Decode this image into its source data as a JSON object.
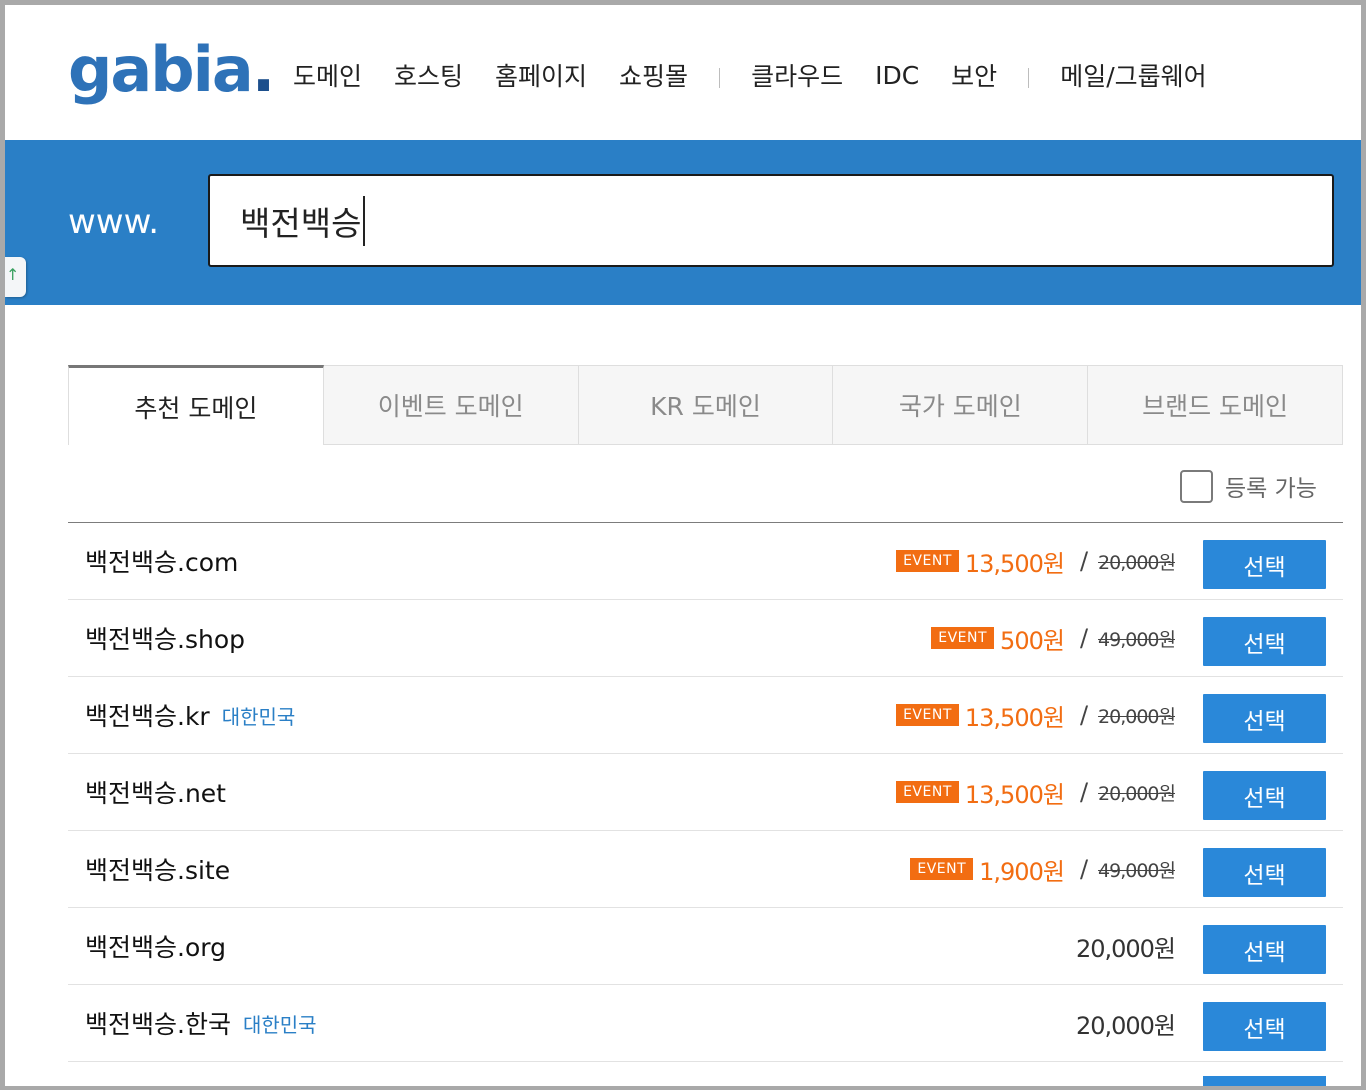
{
  "brand": {
    "logo_text": "gabia",
    "logo_dot": ".",
    "color": "#2e72b8"
  },
  "nav": {
    "group1": [
      "도메인",
      "호스팅",
      "홈페이지",
      "쇼핑몰"
    ],
    "group2": [
      "클라우드",
      "IDC",
      "보안"
    ],
    "group3": [
      "메일/그룹웨어"
    ]
  },
  "search": {
    "prefix": "www.",
    "value": "백전백승"
  },
  "tabs": [
    "추천 도메인",
    "이벤트 도메인",
    "KR 도메인",
    "국가 도메인",
    "브랜드 도메인"
  ],
  "active_tab": 0,
  "filter": {
    "label": "등록 가능",
    "checked": false
  },
  "colors": {
    "band": "#2a7fc6",
    "accent_orange": "#f26d12",
    "button": "#2a88d9"
  },
  "results": [
    {
      "domain": "백전백승.com",
      "country": "",
      "event": "EVENT",
      "price": "13,500원",
      "original": "20,000원",
      "button": "선택"
    },
    {
      "domain": "백전백승.shop",
      "country": "",
      "event": "EVENT",
      "price": "500원",
      "original": "49,000원",
      "button": "선택"
    },
    {
      "domain": "백전백승.kr",
      "country": "대한민국",
      "event": "EVENT",
      "price": "13,500원",
      "original": "20,000원",
      "button": "선택"
    },
    {
      "domain": "백전백승.net",
      "country": "",
      "event": "EVENT",
      "price": "13,500원",
      "original": "20,000원",
      "button": "선택"
    },
    {
      "domain": "백전백승.site",
      "country": "",
      "event": "EVENT",
      "price": "1,900원",
      "original": "49,000원",
      "button": "선택"
    },
    {
      "domain": "백전백승.org",
      "country": "",
      "event": "",
      "price": "20,000원",
      "original": "",
      "button": "선택"
    },
    {
      "domain": "백전백승.한국",
      "country": "대한민국",
      "event": "",
      "price": "20,000원",
      "original": "",
      "button": "선택"
    }
  ]
}
